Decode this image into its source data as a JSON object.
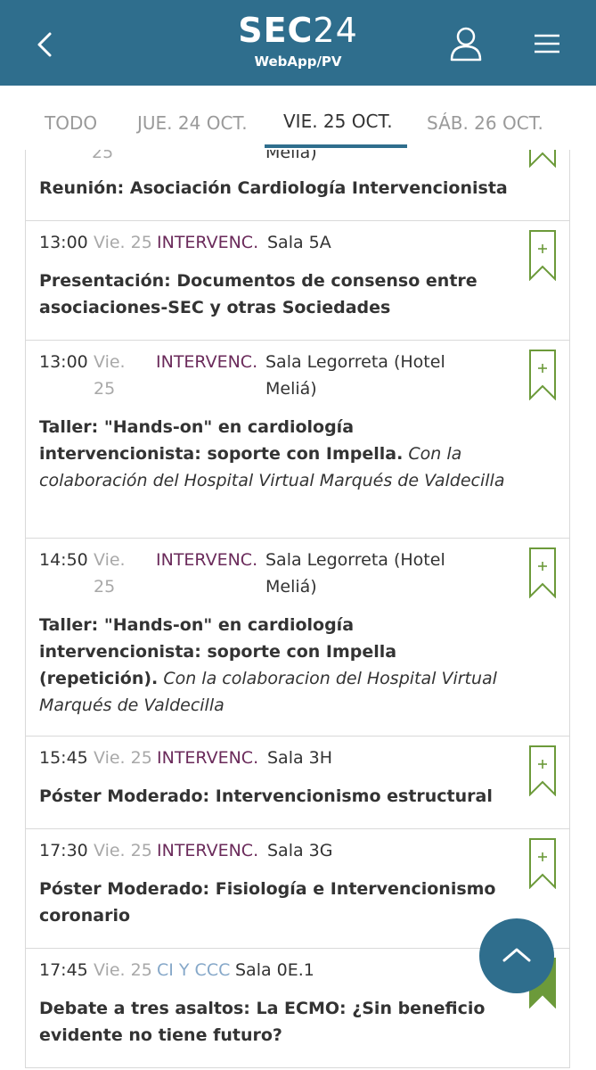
{
  "header": {
    "logo_bold": "SEC",
    "logo_light": "24",
    "subtitle": "WebApp/PV",
    "back_icon": "chevron-left-icon",
    "user_icon": "user-icon",
    "menu_icon": "hamburger-menu-icon",
    "background": "#2f6e8d"
  },
  "tabs": [
    {
      "label": "TODO"
    },
    {
      "label": "JUE. 24 OCT."
    },
    {
      "label": "VIE. 25 OCT.",
      "active": true
    },
    {
      "label": "SÁB. 26 OCT."
    }
  ],
  "sessions": [
    {
      "day_partial": "25",
      "room_partial": "Meliá)",
      "title": "Reunión: Asociación Cardiología Intervencionista",
      "note": "",
      "bookmarked": false
    },
    {
      "time": "13:00",
      "day": "Vie. 25",
      "category": "INTERVENC.",
      "room": "Sala 5A",
      "title": "Presentación: Documentos de consenso entre asociaciones-SEC y otras Sociedades",
      "note": "",
      "bookmarked": false
    },
    {
      "time": "13:00",
      "day": "Vie. 25",
      "category": "INTERVENC.",
      "room": "Sala Legorreta (Hotel Meliá)",
      "title": "Taller: \"Hands-on\" en cardiología intervencionista: soporte con Impella.",
      "note": "Con la colaboración del Hospital Virtual Marqués de Valdecilla",
      "bookmarked": false
    },
    {
      "time": "14:50",
      "day": "Vie. 25",
      "category": "INTERVENC.",
      "room": "Sala Legorreta (Hotel Meliá)",
      "title": "Taller: \"Hands-on\" en cardiología intervencionista: soporte con Impella (repetición).",
      "note": "Con la colaboracion del Hospital Virtual Marqués de Valdecilla",
      "bookmarked": false
    },
    {
      "time": "15:45",
      "day": "Vie. 25",
      "category": "INTERVENC.",
      "room": "Sala 3H",
      "title": "Póster Moderado: Intervencionismo estructural",
      "note": "",
      "bookmarked": false
    },
    {
      "time": "17:30",
      "day": "Vie. 25",
      "category": "INTERVENC.",
      "room": "Sala 3G",
      "title": "Póster Moderado: Fisiología e Intervencionismo coronario",
      "note": "",
      "bookmarked": false
    },
    {
      "time": "17:45",
      "day": "Vie. 25",
      "category": "CI Y CCC",
      "room": "Sala 0E.1",
      "title": "Debate a tres asaltos: La ECMO: ¿Sin beneficio evidente no tiene futuro?",
      "note": "",
      "bookmarked": true
    }
  ],
  "icons": {
    "bookmark": "bookmark-add-icon",
    "bookmark_filled": "bookmark-filled-icon",
    "scroll_top": "chevron-up-icon"
  },
  "colors": {
    "brand": "#2f6e8d",
    "category_intervenc": "#6a2a5a",
    "category_ci": "#86a8c9",
    "bookmark": "#6c9a3a"
  }
}
